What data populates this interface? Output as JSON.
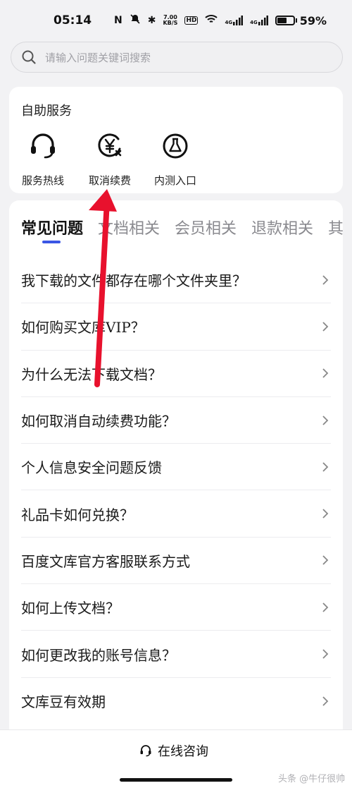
{
  "status_bar": {
    "time": "05:14",
    "net_speed_value": "7.00",
    "net_speed_unit": "KB/S",
    "hd_label": "HD",
    "signal1": "4G",
    "signal2": "4G",
    "battery_percent": "59%",
    "battery_level": 0.59
  },
  "search": {
    "placeholder": "请输入问题关键词搜索"
  },
  "self_service": {
    "title": "自助服务",
    "items": [
      {
        "label": "服务热线",
        "icon": "headset-icon"
      },
      {
        "label": "取消续费",
        "icon": "yen-cancel-icon"
      },
      {
        "label": "内测入口",
        "icon": "flask-icon"
      }
    ]
  },
  "faq": {
    "tabs": [
      {
        "label": "常见问题",
        "active": true
      },
      {
        "label": "文档相关",
        "active": false
      },
      {
        "label": "会员相关",
        "active": false
      },
      {
        "label": "退款相关",
        "active": false
      },
      {
        "label": "其他",
        "active": false
      }
    ],
    "items": [
      "我下载的文件都存在哪个文件夹里？",
      "如何购买文库VIP？",
      "为什么无法下载文档？",
      "如何取消自动续费功能？",
      "个人信息安全问题反馈",
      "礼品卡如何兑换？",
      "百度文库官方客服联系方式",
      "如何上传文档？",
      "如何更改我的账号信息？",
      "文库豆有效期"
    ]
  },
  "bottom": {
    "consult_label": "在线咨询",
    "watermark": "头条 @牛仔很帅"
  },
  "colors": {
    "accent": "#3a56e4",
    "annotation": "#e8112d"
  }
}
